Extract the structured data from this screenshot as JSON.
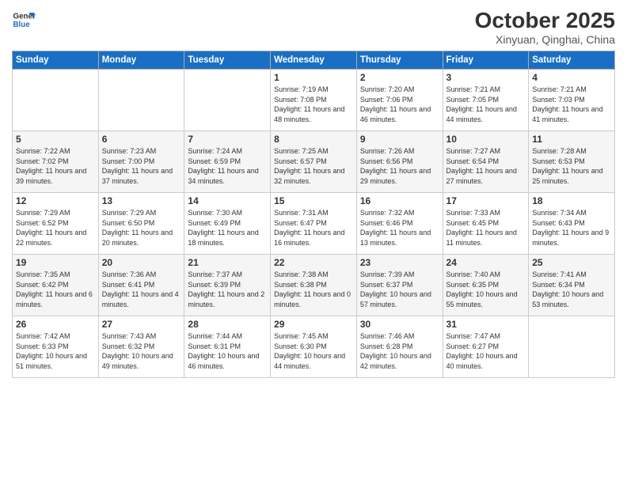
{
  "logo": {
    "line1": "General",
    "line2": "Blue"
  },
  "title": "October 2025",
  "location": "Xinyuan, Qinghai, China",
  "days_of_week": [
    "Sunday",
    "Monday",
    "Tuesday",
    "Wednesday",
    "Thursday",
    "Friday",
    "Saturday"
  ],
  "weeks": [
    [
      {
        "day": "",
        "info": ""
      },
      {
        "day": "",
        "info": ""
      },
      {
        "day": "",
        "info": ""
      },
      {
        "day": "1",
        "info": "Sunrise: 7:19 AM\nSunset: 7:08 PM\nDaylight: 11 hours\nand 48 minutes."
      },
      {
        "day": "2",
        "info": "Sunrise: 7:20 AM\nSunset: 7:06 PM\nDaylight: 11 hours\nand 46 minutes."
      },
      {
        "day": "3",
        "info": "Sunrise: 7:21 AM\nSunset: 7:05 PM\nDaylight: 11 hours\nand 44 minutes."
      },
      {
        "day": "4",
        "info": "Sunrise: 7:21 AM\nSunset: 7:03 PM\nDaylight: 11 hours\nand 41 minutes."
      }
    ],
    [
      {
        "day": "5",
        "info": "Sunrise: 7:22 AM\nSunset: 7:02 PM\nDaylight: 11 hours\nand 39 minutes."
      },
      {
        "day": "6",
        "info": "Sunrise: 7:23 AM\nSunset: 7:00 PM\nDaylight: 11 hours\nand 37 minutes."
      },
      {
        "day": "7",
        "info": "Sunrise: 7:24 AM\nSunset: 6:59 PM\nDaylight: 11 hours\nand 34 minutes."
      },
      {
        "day": "8",
        "info": "Sunrise: 7:25 AM\nSunset: 6:57 PM\nDaylight: 11 hours\nand 32 minutes."
      },
      {
        "day": "9",
        "info": "Sunrise: 7:26 AM\nSunset: 6:56 PM\nDaylight: 11 hours\nand 29 minutes."
      },
      {
        "day": "10",
        "info": "Sunrise: 7:27 AM\nSunset: 6:54 PM\nDaylight: 11 hours\nand 27 minutes."
      },
      {
        "day": "11",
        "info": "Sunrise: 7:28 AM\nSunset: 6:53 PM\nDaylight: 11 hours\nand 25 minutes."
      }
    ],
    [
      {
        "day": "12",
        "info": "Sunrise: 7:29 AM\nSunset: 6:52 PM\nDaylight: 11 hours\nand 22 minutes."
      },
      {
        "day": "13",
        "info": "Sunrise: 7:29 AM\nSunset: 6:50 PM\nDaylight: 11 hours\nand 20 minutes."
      },
      {
        "day": "14",
        "info": "Sunrise: 7:30 AM\nSunset: 6:49 PM\nDaylight: 11 hours\nand 18 minutes."
      },
      {
        "day": "15",
        "info": "Sunrise: 7:31 AM\nSunset: 6:47 PM\nDaylight: 11 hours\nand 16 minutes."
      },
      {
        "day": "16",
        "info": "Sunrise: 7:32 AM\nSunset: 6:46 PM\nDaylight: 11 hours\nand 13 minutes."
      },
      {
        "day": "17",
        "info": "Sunrise: 7:33 AM\nSunset: 6:45 PM\nDaylight: 11 hours\nand 11 minutes."
      },
      {
        "day": "18",
        "info": "Sunrise: 7:34 AM\nSunset: 6:43 PM\nDaylight: 11 hours\nand 9 minutes."
      }
    ],
    [
      {
        "day": "19",
        "info": "Sunrise: 7:35 AM\nSunset: 6:42 PM\nDaylight: 11 hours\nand 6 minutes."
      },
      {
        "day": "20",
        "info": "Sunrise: 7:36 AM\nSunset: 6:41 PM\nDaylight: 11 hours\nand 4 minutes."
      },
      {
        "day": "21",
        "info": "Sunrise: 7:37 AM\nSunset: 6:39 PM\nDaylight: 11 hours\nand 2 minutes."
      },
      {
        "day": "22",
        "info": "Sunrise: 7:38 AM\nSunset: 6:38 PM\nDaylight: 11 hours\nand 0 minutes."
      },
      {
        "day": "23",
        "info": "Sunrise: 7:39 AM\nSunset: 6:37 PM\nDaylight: 10 hours\nand 57 minutes."
      },
      {
        "day": "24",
        "info": "Sunrise: 7:40 AM\nSunset: 6:35 PM\nDaylight: 10 hours\nand 55 minutes."
      },
      {
        "day": "25",
        "info": "Sunrise: 7:41 AM\nSunset: 6:34 PM\nDaylight: 10 hours\nand 53 minutes."
      }
    ],
    [
      {
        "day": "26",
        "info": "Sunrise: 7:42 AM\nSunset: 6:33 PM\nDaylight: 10 hours\nand 51 minutes."
      },
      {
        "day": "27",
        "info": "Sunrise: 7:43 AM\nSunset: 6:32 PM\nDaylight: 10 hours\nand 49 minutes."
      },
      {
        "day": "28",
        "info": "Sunrise: 7:44 AM\nSunset: 6:31 PM\nDaylight: 10 hours\nand 46 minutes."
      },
      {
        "day": "29",
        "info": "Sunrise: 7:45 AM\nSunset: 6:30 PM\nDaylight: 10 hours\nand 44 minutes."
      },
      {
        "day": "30",
        "info": "Sunrise: 7:46 AM\nSunset: 6:28 PM\nDaylight: 10 hours\nand 42 minutes."
      },
      {
        "day": "31",
        "info": "Sunrise: 7:47 AM\nSunset: 6:27 PM\nDaylight: 10 hours\nand 40 minutes."
      },
      {
        "day": "",
        "info": ""
      }
    ]
  ]
}
